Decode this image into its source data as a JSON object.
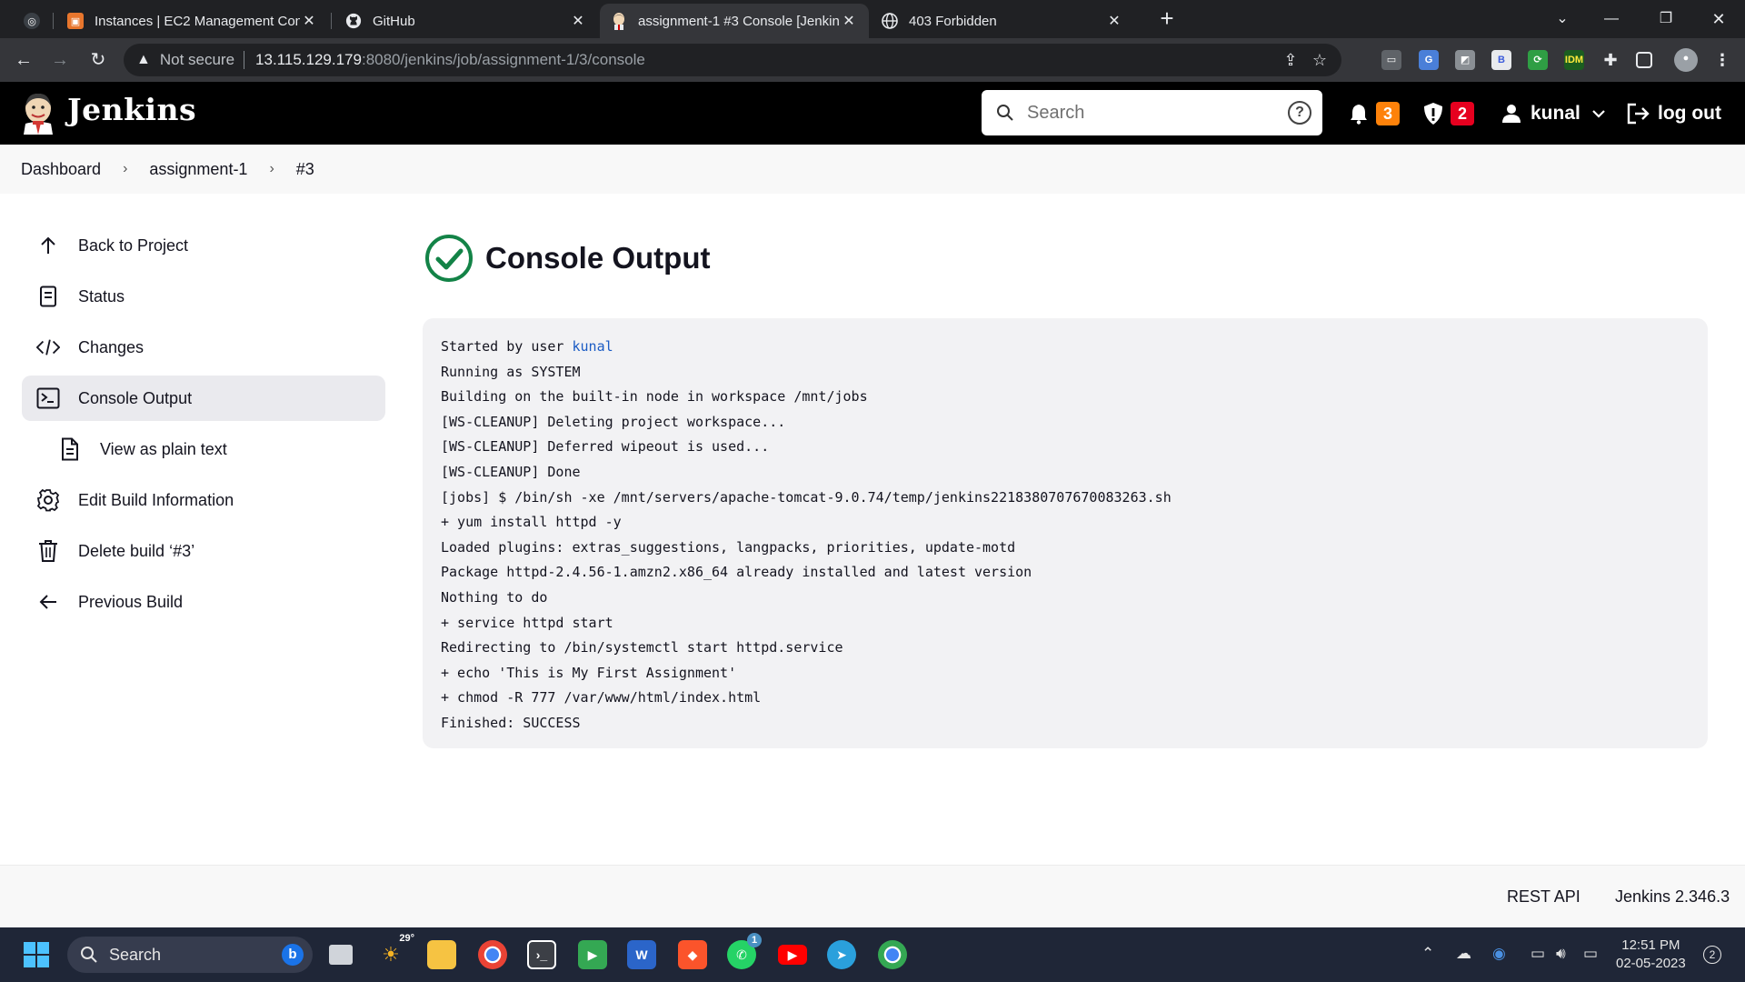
{
  "browser": {
    "tabs": [
      {
        "title": "Instances | EC2 Management Con",
        "icon": "aws-icon",
        "color": "#e8762d"
      },
      {
        "title": "GitHub",
        "icon": "github-icon"
      },
      {
        "title": "assignment-1 #3 Console [Jenkin",
        "icon": "jenkins-icon"
      },
      {
        "title": "403 Forbidden",
        "icon": "globe-icon"
      }
    ],
    "security_label": "Not secure",
    "url_host": "13.115.129.179",
    "url_path": ":8080/jenkins/job/assignment-1/3/console"
  },
  "jenkins": {
    "brand": "Jenkins",
    "search_placeholder": "Search",
    "notifications_count": "3",
    "security_count": "2",
    "user": "kunal",
    "logout": "log out",
    "colors": {
      "notify": "#fe820a",
      "security": "#e6001f",
      "success": "#138347",
      "link": "#1a5bc4"
    }
  },
  "breadcrumb": [
    "Dashboard",
    "assignment-1",
    "#3"
  ],
  "sidebar": [
    {
      "label": "Back to Project",
      "icon": "arrow-up-icon"
    },
    {
      "label": "Status",
      "icon": "document-icon"
    },
    {
      "label": "Changes",
      "icon": "code-icon"
    },
    {
      "label": "Console Output",
      "icon": "terminal-icon",
      "active": true
    },
    {
      "label": "View as plain text",
      "icon": "file-text-icon"
    },
    {
      "label": "Edit Build Information",
      "icon": "gear-icon"
    },
    {
      "label": "Delete build ‘#3’",
      "icon": "trash-icon"
    },
    {
      "label": "Previous Build",
      "icon": "arrow-left-icon"
    }
  ],
  "main": {
    "title": "Console Output",
    "status": "success",
    "console": {
      "started_prefix": "Started by user ",
      "started_user": "kunal",
      "lines": [
        "Running as SYSTEM",
        "Building on the built-in node in workspace /mnt/jobs",
        "[WS-CLEANUP] Deleting project workspace...",
        "[WS-CLEANUP] Deferred wipeout is used...",
        "[WS-CLEANUP] Done",
        "[jobs] $ /bin/sh -xe /mnt/servers/apache-tomcat-9.0.74/temp/jenkins2218380707670083263.sh",
        "+ yum install httpd -y",
        "Loaded plugins: extras_suggestions, langpacks, priorities, update-motd",
        "Package httpd-2.4.56-1.amzn2.x86_64 already installed and latest version",
        "Nothing to do",
        "+ service httpd start",
        "Redirecting to /bin/systemctl start httpd.service",
        "+ echo 'This is My First Assignment'",
        "+ chmod -R 777 /var/www/html/index.html",
        "Finished: SUCCESS"
      ]
    }
  },
  "footer": {
    "rest_api": "REST API",
    "version": "Jenkins 2.346.3"
  },
  "taskbar": {
    "search_label": "Search",
    "weather_temp": "29°",
    "whatsapp_badge": "1",
    "time": "12:51 PM",
    "date": "02-05-2023",
    "notification_count": "2"
  }
}
